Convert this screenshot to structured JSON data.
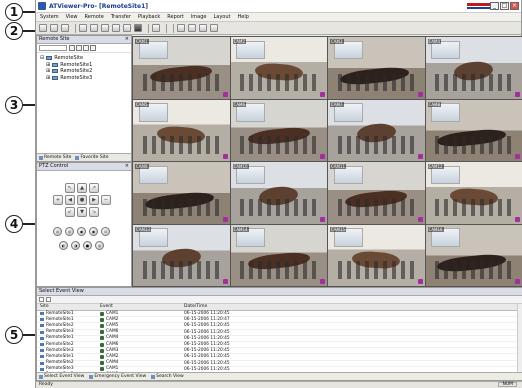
{
  "callouts": [
    "1",
    "2",
    "3",
    "4",
    "5"
  ],
  "window": {
    "title": "ATViewer-Pro- [RemoteSite1]",
    "min": "_",
    "max": "□",
    "close": "×"
  },
  "menu": [
    "System",
    "View",
    "Remote",
    "Transfer",
    "Playback",
    "Report",
    "Image",
    "Layout",
    "Help"
  ],
  "remote_site": {
    "title": "Remote Site",
    "close": "×",
    "root": "RemoteSite",
    "children": [
      "RemoteSite1",
      "RemoteSite2",
      "RemoteSite3"
    ],
    "tabs": [
      "Remote Site",
      "Favorite Site"
    ]
  },
  "ptz": {
    "title": "PTZ Control",
    "close": "×"
  },
  "cameras": [
    {
      "label": "CAM1",
      "variant": "v1"
    },
    {
      "label": "CAM2",
      "variant": "v2"
    },
    {
      "label": "CAM3",
      "variant": "v3"
    },
    {
      "label": "CAM4",
      "variant": "v4"
    },
    {
      "label": "CAM5",
      "variant": "v2"
    },
    {
      "label": "CAM6",
      "variant": "v1"
    },
    {
      "label": "CAM7",
      "variant": "v4"
    },
    {
      "label": "CAM8",
      "variant": "v3"
    },
    {
      "label": "CAM9",
      "variant": "v3"
    },
    {
      "label": "CAM10",
      "variant": "v4"
    },
    {
      "label": "CAM11",
      "variant": "v1"
    },
    {
      "label": "CAM12",
      "variant": "v2"
    },
    {
      "label": "CAM13",
      "variant": "v4"
    },
    {
      "label": "CAM14",
      "variant": "v1"
    },
    {
      "label": "CAM15",
      "variant": "v2"
    },
    {
      "label": "CAM16",
      "variant": "v3"
    }
  ],
  "events": {
    "title": "Select Event View",
    "columns": [
      "Site",
      "Event",
      "Date/Time"
    ],
    "rows": [
      [
        "RemoteSite1",
        "CAM1",
        "06-15-2006 11:20:45"
      ],
      [
        "RemoteSite1",
        "CAM2",
        "06-15-2006 11:20:47"
      ],
      [
        "RemoteSite2",
        "CAM5",
        "06-15-2006 11:20:45"
      ],
      [
        "RemoteSite3",
        "CAM6",
        "06-15-2006 11:20:45"
      ],
      [
        "RemoteSite1",
        "CAM4",
        "06-15-2006 11:20:45"
      ],
      [
        "RemoteSite2",
        "CAM6",
        "06-15-2006 11:20:45"
      ],
      [
        "RemoteSite3",
        "CAM3",
        "06-15-2006 11:20:45"
      ],
      [
        "RemoteSite1",
        "CAM2",
        "06-15-2006 11:20:45"
      ],
      [
        "RemoteSite2",
        "CAM4",
        "06-15-2006 11:20:45"
      ],
      [
        "RemoteSite3",
        "CAM1",
        "06-15-2006 11:20:45"
      ],
      [
        "RemoteSite2",
        "CAM3",
        "06-15-2006 11:20:45"
      ]
    ],
    "tabs": [
      "Select Event View",
      "Emergency Event View",
      "Search View"
    ]
  },
  "status": {
    "left": "Ready",
    "right": "NUM"
  }
}
